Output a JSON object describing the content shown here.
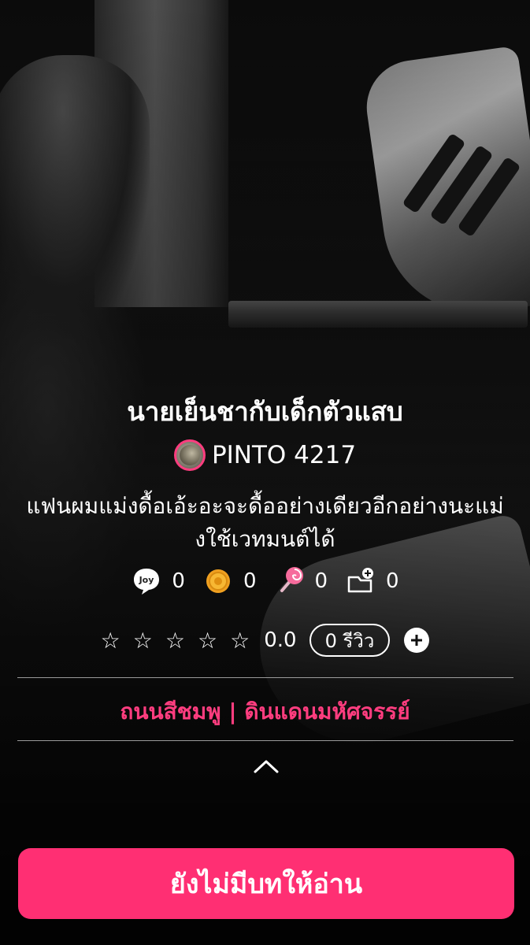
{
  "story": {
    "title": "นายเย็นชากับเด็กตัวแสบ",
    "author": "PINTO 4217",
    "description": "แฟนผมแม่งดื้อเอ้ะอะจะดื้ออย่างเดียวอีกอย่างนะแม่งใช้เวทมนต์ได้"
  },
  "stats": {
    "joy_icon": "joy-icon",
    "joy": "0",
    "coin_icon": "coin-icon",
    "coins": "0",
    "candy_icon": "lollipop-icon",
    "candy": "0",
    "add_shelf_icon": "add-to-shelf-icon",
    "shelf": "0"
  },
  "rating": {
    "stars_filled": 0,
    "stars_total": 5,
    "value": "0.0",
    "reviews_label": "0 รีวิว"
  },
  "category": "ถนนสีชมพู | ดินแดนมหัศจรรย์",
  "read_button": "ยังไม่มีบทให้อ่าน",
  "colors": {
    "accent": "#ff2f73",
    "category": "#ff3d7f",
    "background": "#000000"
  }
}
